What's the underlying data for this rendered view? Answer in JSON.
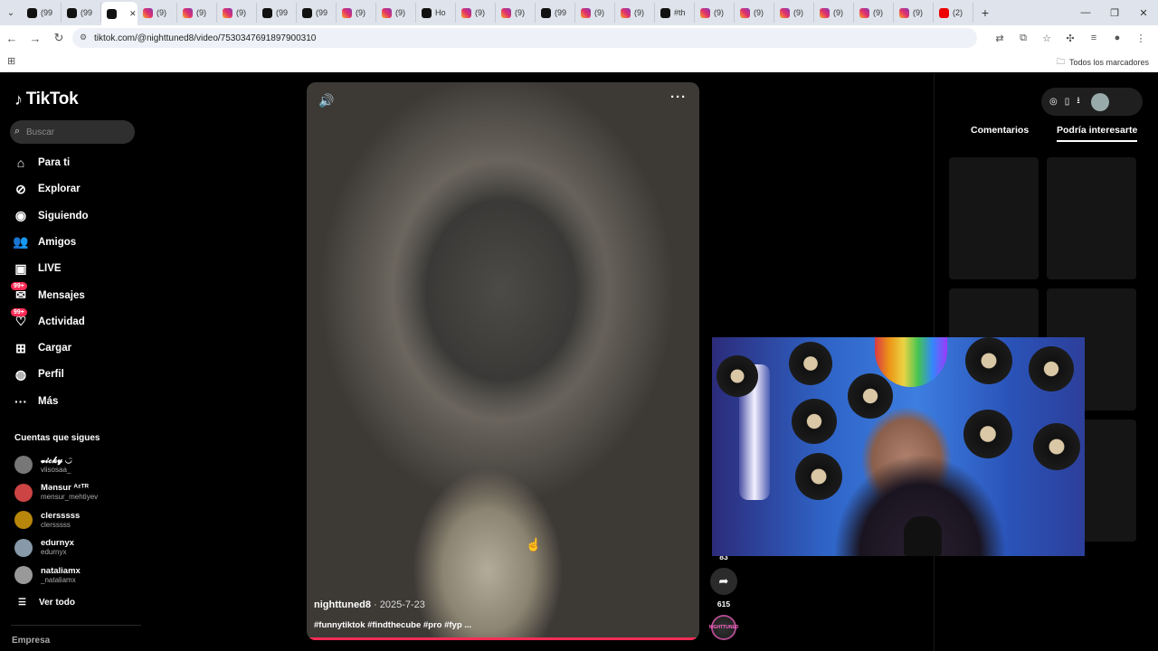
{
  "browser": {
    "tabs": [
      {
        "icon": "tiktok-icon",
        "label": "(99"
      },
      {
        "icon": "tiktok-icon",
        "label": "(99"
      },
      {
        "icon": "tiktok-icon",
        "label": "",
        "active": true
      },
      {
        "icon": "instagram-icon",
        "label": "(9)"
      },
      {
        "icon": "instagram-icon",
        "label": "(9)"
      },
      {
        "icon": "instagram-icon",
        "label": "(9)"
      },
      {
        "icon": "tiktok-icon",
        "label": "(99"
      },
      {
        "icon": "tiktok-icon",
        "label": "(99"
      },
      {
        "icon": "instagram-icon",
        "label": "(9)"
      },
      {
        "icon": "instagram-icon",
        "label": "(9)"
      },
      {
        "icon": "tiktok-icon",
        "label": "Ho"
      },
      {
        "icon": "instagram-icon",
        "label": "(9)"
      },
      {
        "icon": "instagram-icon",
        "label": "(9)"
      },
      {
        "icon": "tiktok-icon",
        "label": "(99"
      },
      {
        "icon": "instagram-icon",
        "label": "(9)"
      },
      {
        "icon": "instagram-icon",
        "label": "(9)"
      },
      {
        "icon": "tiktok-icon",
        "label": "#th"
      },
      {
        "icon": "instagram-icon",
        "label": "(9)"
      },
      {
        "icon": "instagram-icon",
        "label": "(9)"
      },
      {
        "icon": "instagram-icon",
        "label": "(9)"
      },
      {
        "icon": "instagram-icon",
        "label": "(9)"
      },
      {
        "icon": "instagram-icon",
        "label": "(9)"
      },
      {
        "icon": "instagram-icon",
        "label": "(9)"
      },
      {
        "icon": "youtube-icon",
        "label": "(2)"
      }
    ],
    "url": "tiktok.com/@nighttuned8/video/7530347691897900310",
    "bookmarks_label": "Todos los marcadores"
  },
  "tiktok": {
    "logo": "TikTok",
    "search_placeholder": "Buscar",
    "nav": [
      {
        "label": "Para ti",
        "icon": "home-icon"
      },
      {
        "label": "Explorar",
        "icon": "compass-icon"
      },
      {
        "label": "Siguiendo",
        "icon": "following-avatar-icon"
      },
      {
        "label": "Amigos",
        "icon": "friends-icon"
      },
      {
        "label": "LIVE",
        "icon": "live-tv-icon"
      },
      {
        "label": "Mensajes",
        "icon": "messages-icon",
        "badge": "99+"
      },
      {
        "label": "Actividad",
        "icon": "activity-icon",
        "badge": "99+"
      },
      {
        "label": "Cargar",
        "icon": "upload-icon"
      },
      {
        "label": "Perfil",
        "icon": "profile-avatar-icon"
      },
      {
        "label": "Más",
        "icon": "more-dots-icon"
      }
    ],
    "following_title": "Cuentas que sigues",
    "following": [
      {
        "name": "𝓿𝓲𝓬𝓴𝔂 ◡̈",
        "handle": "viisosaa_"
      },
      {
        "name": "Mənsur ᴬᶻᵀᴿ",
        "handle": "mensur_mehtiyev"
      },
      {
        "name": "clersssss",
        "handle": "clersssss"
      },
      {
        "name": "edurnyx",
        "handle": "edurnyx"
      },
      {
        "name": "nataliamx",
        "handle": "_nataliamx"
      }
    ],
    "see_all": "Ver todo",
    "empresa": "Empresa",
    "video": {
      "author": "nighttuned8",
      "date": "2025-7-23",
      "hashtags": "#funnytiktok #findthecube #pro #fyp ...",
      "progress": 0.99
    },
    "actions": {
      "count_top": "83",
      "share_count": "615",
      "music_label": "NIGHTTUNED"
    },
    "right_panel": {
      "tabs": [
        "Comentarios",
        "Podría interesarte"
      ]
    }
  }
}
